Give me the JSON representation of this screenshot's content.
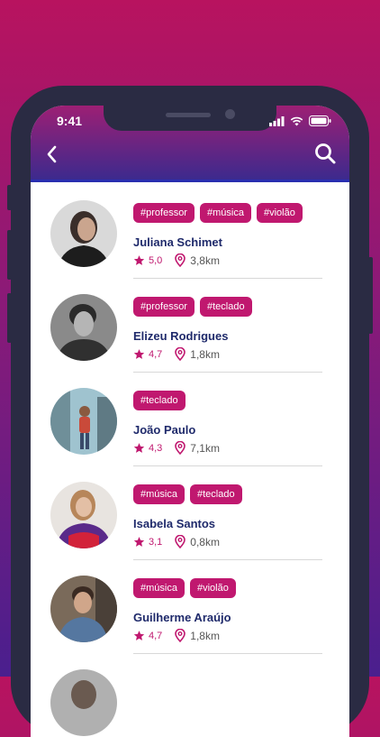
{
  "status_bar": {
    "time": "9:41"
  },
  "header": {
    "back_icon": "chevron-left-icon",
    "search_icon": "search-icon"
  },
  "colors": {
    "accent": "#c0186f",
    "name": "#1f2a6b"
  },
  "profiles": [
    {
      "name": "Juliana Schimet",
      "tags": [
        "#professor",
        "#música",
        "#violão"
      ],
      "rating": "5,0",
      "distance": "3,8km"
    },
    {
      "name": "Elizeu Rodrigues",
      "tags": [
        "#professor",
        "#teclado"
      ],
      "rating": "4,7",
      "distance": "1,8km"
    },
    {
      "name": "João Paulo",
      "tags": [
        "#teclado"
      ],
      "rating": "4,3",
      "distance": "7,1km"
    },
    {
      "name": "Isabela Santos",
      "tags": [
        "#música",
        "#teclado"
      ],
      "rating": "3,1",
      "distance": "0,8km"
    },
    {
      "name": "Guilherme Araújo",
      "tags": [
        "#música",
        "#violão"
      ],
      "rating": "4,7",
      "distance": "1,8km"
    }
  ]
}
